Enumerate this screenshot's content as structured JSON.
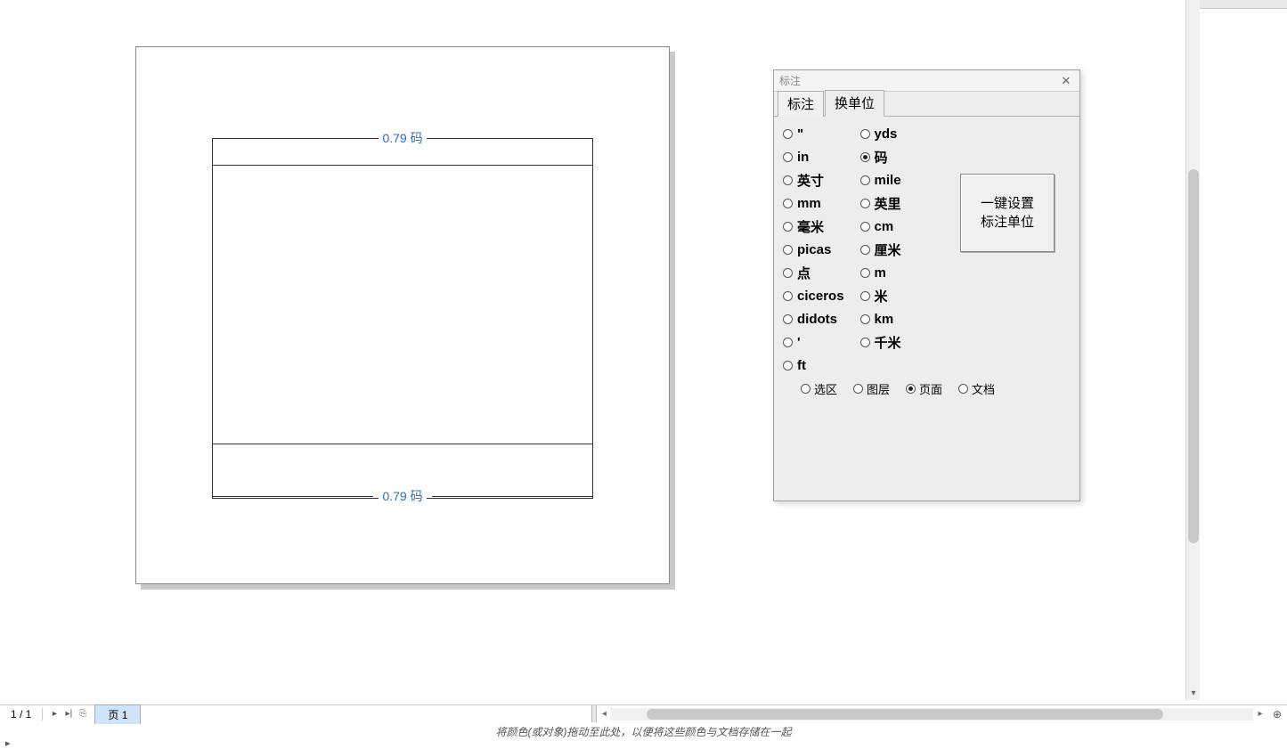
{
  "canvas": {
    "dim_top": "0.79 码",
    "dim_bottom": "0.79 码"
  },
  "dialog": {
    "title": "标注",
    "tabs": [
      {
        "label": "标注",
        "active": false
      },
      {
        "label": "换单位",
        "active": true
      }
    ],
    "units_col1": [
      {
        "label": "\"",
        "checked": false
      },
      {
        "label": "in",
        "checked": false
      },
      {
        "label": "英寸",
        "checked": false
      },
      {
        "label": "mm",
        "checked": false
      },
      {
        "label": "毫米",
        "checked": false
      },
      {
        "label": "picas",
        "checked": false
      },
      {
        "label": "点",
        "checked": false
      },
      {
        "label": "ciceros",
        "checked": false
      },
      {
        "label": "didots",
        "checked": false
      },
      {
        "label": "'",
        "checked": false
      },
      {
        "label": "ft",
        "checked": false
      }
    ],
    "units_col2": [
      {
        "label": "yds",
        "checked": false
      },
      {
        "label": "码",
        "checked": true
      },
      {
        "label": "mile",
        "checked": false
      },
      {
        "label": "英里",
        "checked": false
      },
      {
        "label": "cm",
        "checked": false
      },
      {
        "label": "厘米",
        "checked": false
      },
      {
        "label": "m",
        "checked": false
      },
      {
        "label": "米",
        "checked": false
      },
      {
        "label": "km",
        "checked": false
      },
      {
        "label": "千米",
        "checked": false
      }
    ],
    "button_label": "一键设置\n标注单位",
    "scope": [
      {
        "label": "选区",
        "checked": false
      },
      {
        "label": "图层",
        "checked": false
      },
      {
        "label": "页面",
        "checked": true
      },
      {
        "label": "文档",
        "checked": false
      }
    ]
  },
  "bottom": {
    "page_indicator": "1 / 1",
    "page_tab": "页 1",
    "hint": "将颜色(或对象)拖动至此处，以便将这些颜色与文档存储在一起"
  }
}
